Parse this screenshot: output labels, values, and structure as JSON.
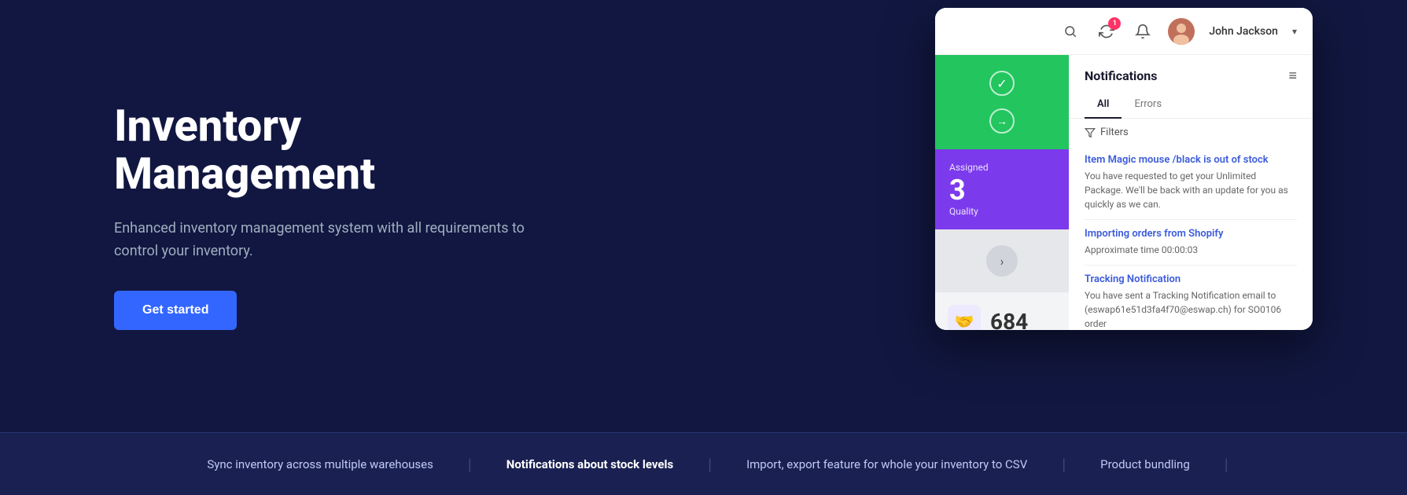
{
  "page": {
    "background": "#111740"
  },
  "hero": {
    "title": "Inventory Management",
    "subtitle": "Enhanced inventory management system with all requirements to control your inventory.",
    "cta_label": "Get started"
  },
  "footer": {
    "items": [
      {
        "id": "sync",
        "label": "Sync inventory across multiple warehouses",
        "bold": false
      },
      {
        "id": "notifications",
        "label": "Notifications about stock levels",
        "bold": true
      },
      {
        "id": "import",
        "label": "Import, export feature for whole your inventory to CSV",
        "bold": false
      },
      {
        "id": "bundling",
        "label": "Product bundling",
        "bold": false
      }
    ]
  },
  "ui_card": {
    "user": {
      "name": "John Jackson",
      "avatar_alt": "user avatar"
    },
    "notification_badge": "1",
    "panels": {
      "assigned_label": "Assigned",
      "assigned_number": "3",
      "assigned_sub": "Quality",
      "stat_number": "684"
    },
    "notifications": {
      "title": "Notifications",
      "tabs": [
        "All",
        "Errors"
      ],
      "active_tab": "All",
      "filter_label": "Filters",
      "items": [
        {
          "id": "item1",
          "title": "Item Magic mouse /black is out of stock",
          "body": "You have requested to get your Unlimited Package. We'll be back with an update for you as quickly as we can."
        },
        {
          "id": "item2",
          "title": "Importing orders from Shopify",
          "body": "Approximate time 00:00:03"
        },
        {
          "id": "item3",
          "title": "Tracking Notification",
          "body": "You have sent a Tracking Notification email to (eswap61e51d3fa4f70@eswap.ch) for SO0106 order"
        }
      ]
    }
  }
}
